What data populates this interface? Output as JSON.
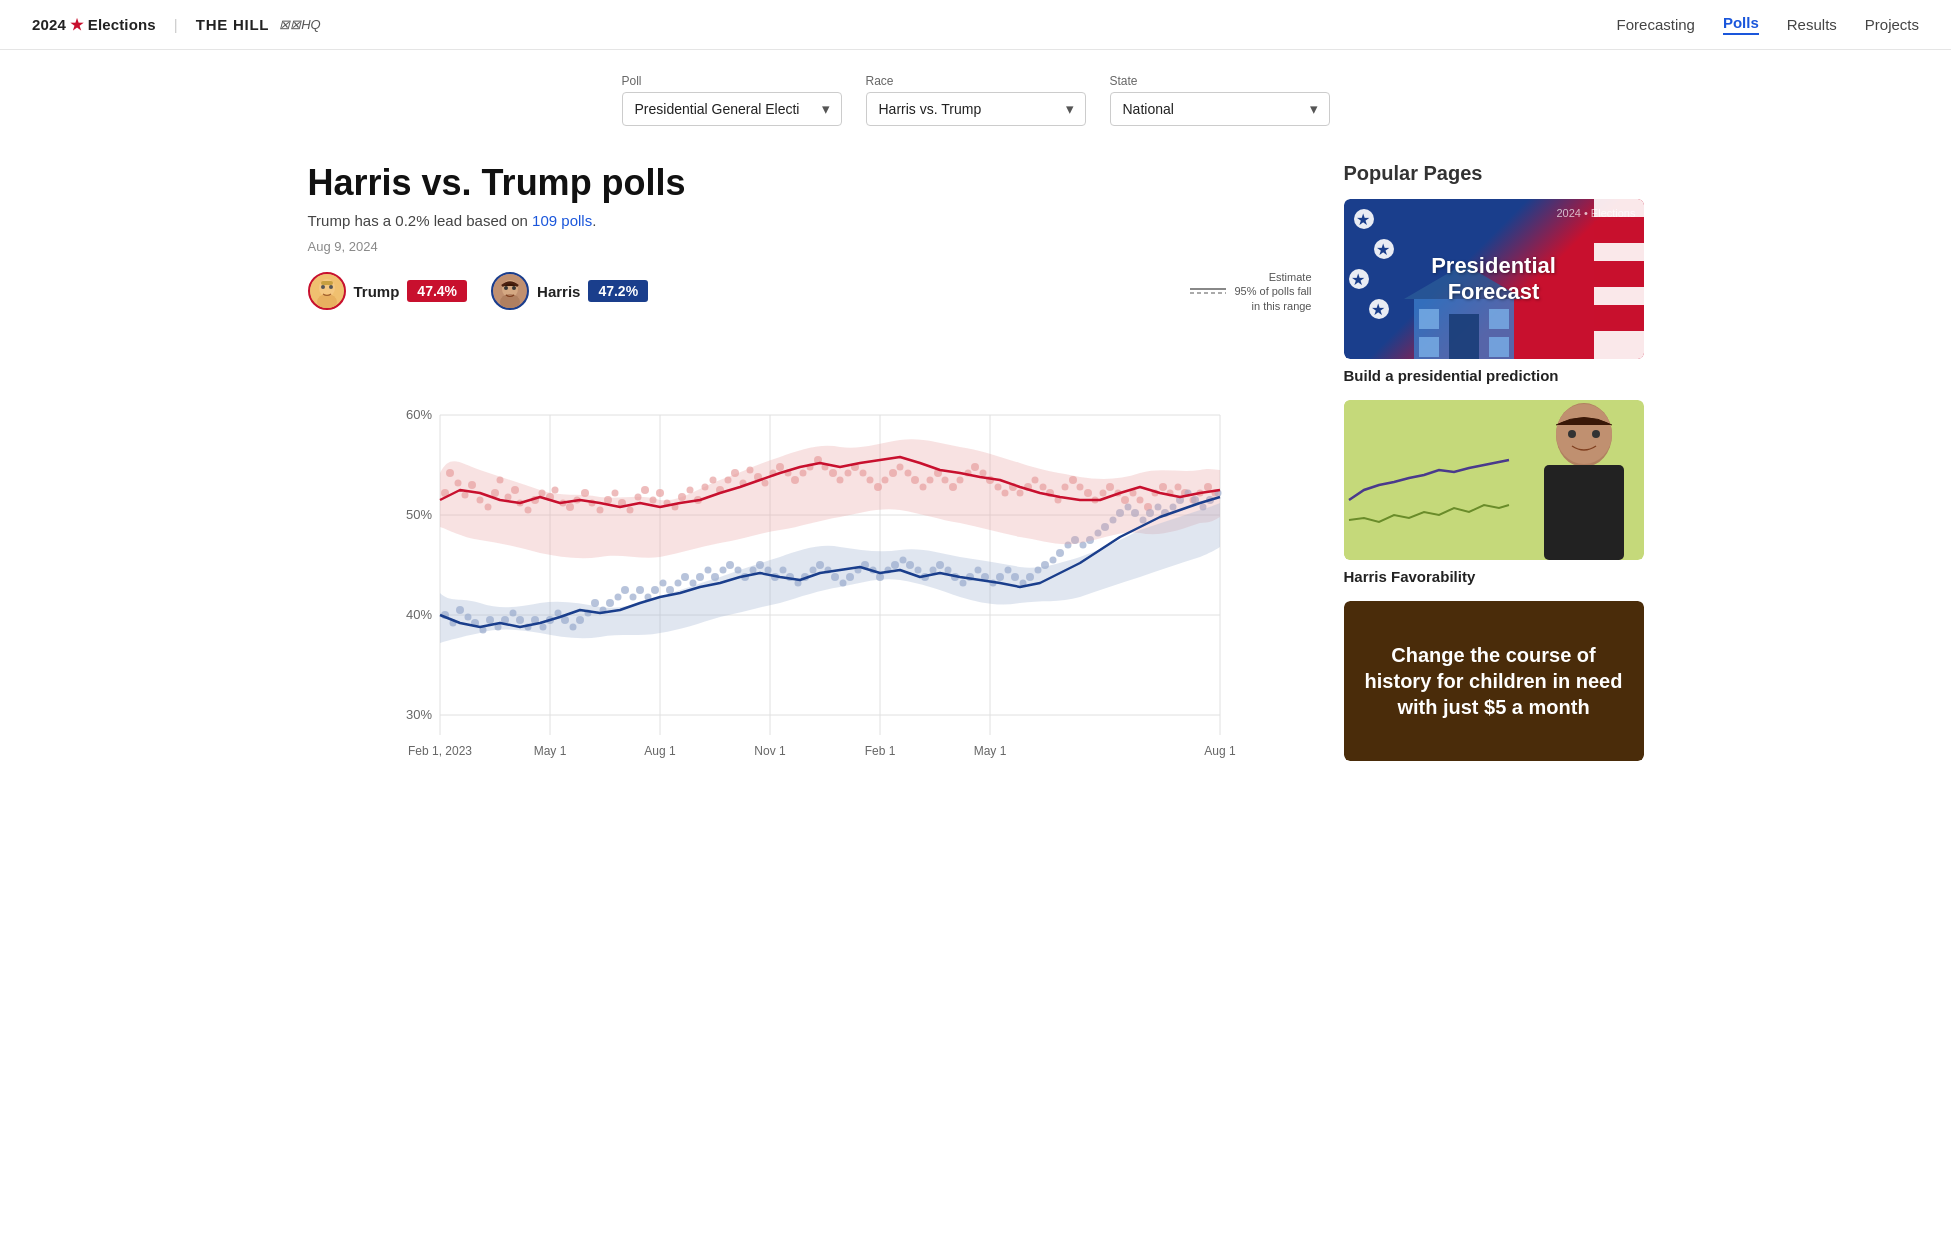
{
  "header": {
    "brand": "2024 ★ Elections",
    "brand_elections": "2024",
    "brand_star": "★",
    "brand_the_hill": "THE HILL",
    "brand_decisionhq": "⊠⊠HQ",
    "nav": [
      {
        "label": "Forecasting",
        "id": "forecasting",
        "active": false
      },
      {
        "label": "Polls",
        "id": "polls",
        "active": true
      },
      {
        "label": "Results",
        "id": "results",
        "active": false
      },
      {
        "label": "Projects",
        "id": "projects",
        "active": false
      }
    ]
  },
  "filters": {
    "poll_label": "Poll",
    "poll_value": "Presidential General Electi",
    "race_label": "Race",
    "race_value": "Harris vs. Trump",
    "state_label": "State",
    "state_value": "National"
  },
  "chart": {
    "title": "Harris vs. Trump polls",
    "subtitle_text": "Trump has a 0.2% lead based on ",
    "subtitle_link": "109 polls",
    "subtitle_end": ".",
    "date": "Aug 9, 2024",
    "trump_name": "Trump",
    "trump_pct": "47.4%",
    "harris_name": "Harris",
    "harris_pct": "47.2%",
    "estimate_label": "Estimate",
    "range_label": "95% of polls fall\nin this range",
    "y_labels": [
      "60%",
      "50%",
      "40%",
      "30%"
    ],
    "x_labels": [
      "Feb 1, 2023",
      "May 1",
      "Aug 1",
      "Nov 1",
      "Feb 1",
      "May 1",
      "Aug 1"
    ]
  },
  "sidebar": {
    "title": "Popular Pages",
    "cards": [
      {
        "id": "presidential-forecast",
        "label": "Build a presidential prediction",
        "eyebrow": "2024 • Elections",
        "title_text": "Presidential\nForecast"
      },
      {
        "id": "harris-favorability",
        "label": "Harris Favorability"
      },
      {
        "id": "change-course",
        "label": "Change the course of history for children in need with just $5 a month"
      }
    ]
  }
}
